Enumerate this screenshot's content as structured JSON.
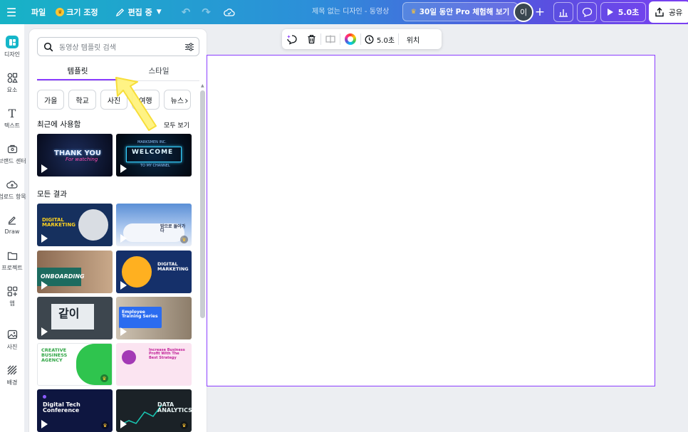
{
  "topbar": {
    "file_label": "파일",
    "resize_label": "크기 조정",
    "edit_label": "편집 중",
    "doc_title": "제목 없는 디자인 - 동영상",
    "pro_label": "30일 동안 Pro 체험해 보기",
    "avatar_initial": "이",
    "play_label": "5.0초",
    "share_label": "공유"
  },
  "rail": {
    "items": [
      {
        "label": "디자인",
        "icon": "design-icon"
      },
      {
        "label": "요소",
        "icon": "elements-icon"
      },
      {
        "label": "텍스트",
        "icon": "text-icon"
      },
      {
        "label": "브랜드 센터",
        "icon": "brand-icon"
      },
      {
        "label": "업로드 항목",
        "icon": "upload-icon"
      },
      {
        "label": "Draw",
        "icon": "draw-icon"
      },
      {
        "label": "프로젝트",
        "icon": "folder-icon"
      },
      {
        "label": "앱",
        "icon": "apps-icon"
      },
      {
        "label": "사진",
        "icon": "photo-icon"
      },
      {
        "label": "배경",
        "icon": "background-icon"
      }
    ]
  },
  "panel": {
    "search_placeholder": "동영상 템플릿 검색",
    "tabs": [
      {
        "label": "템플릿"
      },
      {
        "label": "스타일"
      }
    ],
    "chips": [
      {
        "label": "가을"
      },
      {
        "label": "학교"
      },
      {
        "label": "사진"
      },
      {
        "label": "여행"
      },
      {
        "label": "뉴스"
      }
    ],
    "recent_title": "최근에 사용함",
    "see_all": "모두 보기",
    "all_title": "모든 결과",
    "recent": [
      {
        "text": "THANK YOU",
        "sub": "For watching"
      },
      {
        "text": "WELCOME",
        "sub": "TO MY CHANNEL",
        "brand": "MARKSMEN INC."
      }
    ],
    "results": [
      {
        "text": "DIGITAL MARKETING"
      },
      {
        "text": "밤으로 들어가다"
      },
      {
        "text": "ONBOARDING"
      },
      {
        "text": "DIGITAL MARKETING"
      },
      {
        "text": "같이"
      },
      {
        "text": "Employee Training Series"
      },
      {
        "text": "CREATIVE BUSINESS AGENCY"
      },
      {
        "text": "Increase Business Profit With The Best Strategy"
      },
      {
        "text": "Digital Tech Conference"
      },
      {
        "text": "DATA ANALYTICS"
      }
    ]
  },
  "float_bar": {
    "duration": "5.0초",
    "position": "위치"
  },
  "colors": {
    "accent": "#8b3dff",
    "brand_teal": "#15b6c9"
  }
}
